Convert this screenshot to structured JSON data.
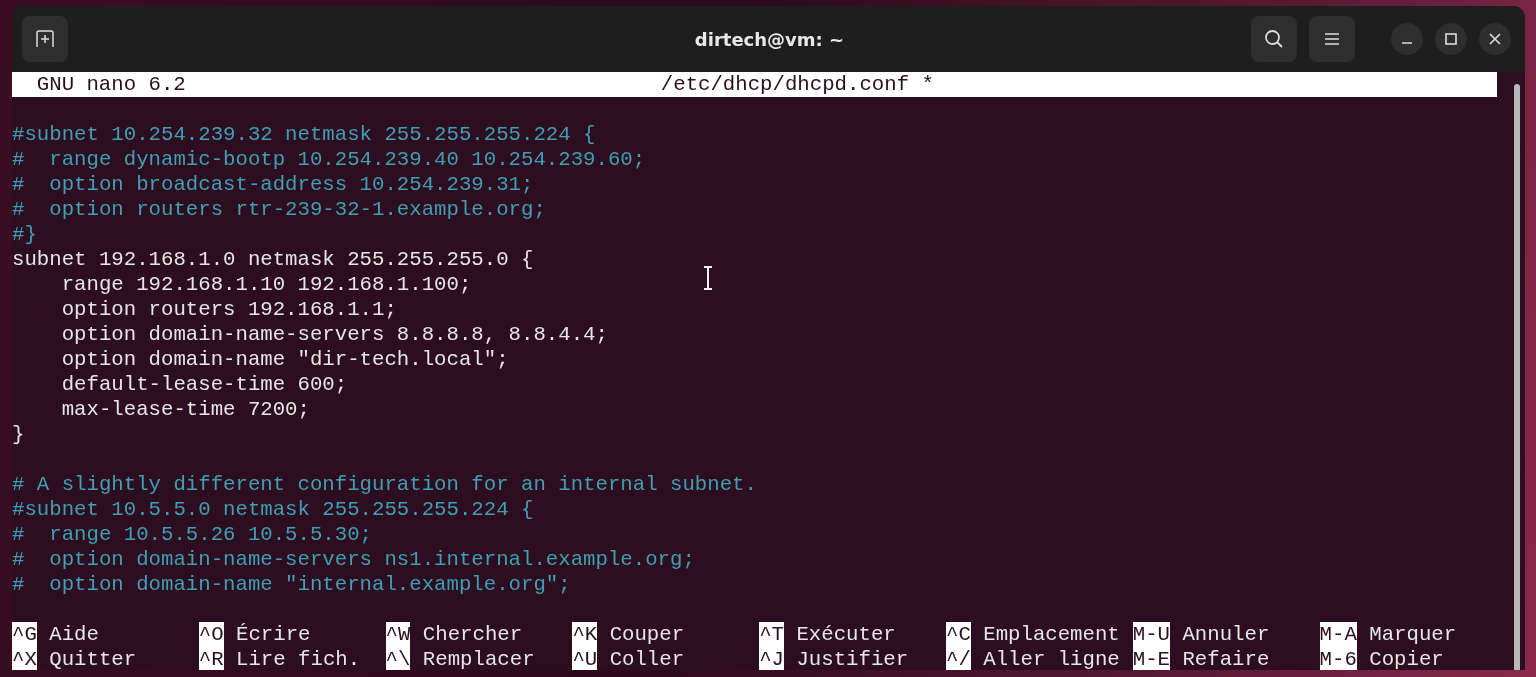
{
  "window": {
    "title": "dirtech@vm: ~"
  },
  "nano_header": {
    "version": "GNU nano 6.2",
    "filename": "/etc/dhcp/dhcpd.conf *"
  },
  "lines": [
    {
      "kind": "blank"
    },
    {
      "kind": "comment",
      "text": "#subnet 10.254.239.32 netmask 255.255.255.224 {"
    },
    {
      "kind": "comment",
      "text": "#  range dynamic-bootp 10.254.239.40 10.254.239.60;"
    },
    {
      "kind": "comment",
      "text": "#  option broadcast-address 10.254.239.31;"
    },
    {
      "kind": "comment",
      "text": "#  option routers rtr-239-32-1.example.org;"
    },
    {
      "kind": "comment",
      "text": "#}"
    },
    {
      "kind": "code",
      "text": "subnet 192.168.1.0 netmask 255.255.255.0 {"
    },
    {
      "kind": "code",
      "text": "    range 192.168.1.10 192.168.1.100;"
    },
    {
      "kind": "code",
      "text": "    option routers 192.168.1.1;"
    },
    {
      "kind": "code",
      "text": "    option domain-name-servers 8.8.8.8, 8.8.4.4;"
    },
    {
      "kind": "code",
      "text": "    option domain-name \"dir-tech.local\";"
    },
    {
      "kind": "code",
      "text": "    default-lease-time 600;"
    },
    {
      "kind": "code",
      "text": "    max-lease-time 7200;"
    },
    {
      "kind": "code",
      "text": "}"
    },
    {
      "kind": "blank"
    },
    {
      "kind": "comment",
      "text": "# A slightly different configuration for an internal subnet."
    },
    {
      "kind": "comment",
      "text": "#subnet 10.5.5.0 netmask 255.255.255.224 {"
    },
    {
      "kind": "comment",
      "text": "#  range 10.5.5.26 10.5.5.30;"
    },
    {
      "kind": "comment",
      "text": "#  option domain-name-servers ns1.internal.example.org;"
    },
    {
      "kind": "comment",
      "text": "#  option domain-name \"internal.example.org\";"
    },
    {
      "kind": "blank"
    }
  ],
  "shortcuts": [
    {
      "key": "^G",
      "label": "Aide"
    },
    {
      "key": "^O",
      "label": "Écrire"
    },
    {
      "key": "^W",
      "label": "Chercher"
    },
    {
      "key": "^K",
      "label": "Couper"
    },
    {
      "key": "^T",
      "label": "Exécuter"
    },
    {
      "key": "^C",
      "label": "Emplacement"
    },
    {
      "key": "M-U",
      "label": "Annuler"
    },
    {
      "key": "M-A",
      "label": "Marquer"
    },
    {
      "key": "^X",
      "label": "Quitter"
    },
    {
      "key": "^R",
      "label": "Lire fich."
    },
    {
      "key": "^\\",
      "label": "Remplacer"
    },
    {
      "key": "^U",
      "label": "Coller"
    },
    {
      "key": "^J",
      "label": "Justifier"
    },
    {
      "key": "^/",
      "label": "Aller ligne"
    },
    {
      "key": "M-E",
      "label": "Refaire"
    },
    {
      "key": "M-6",
      "label": "Copier"
    }
  ]
}
